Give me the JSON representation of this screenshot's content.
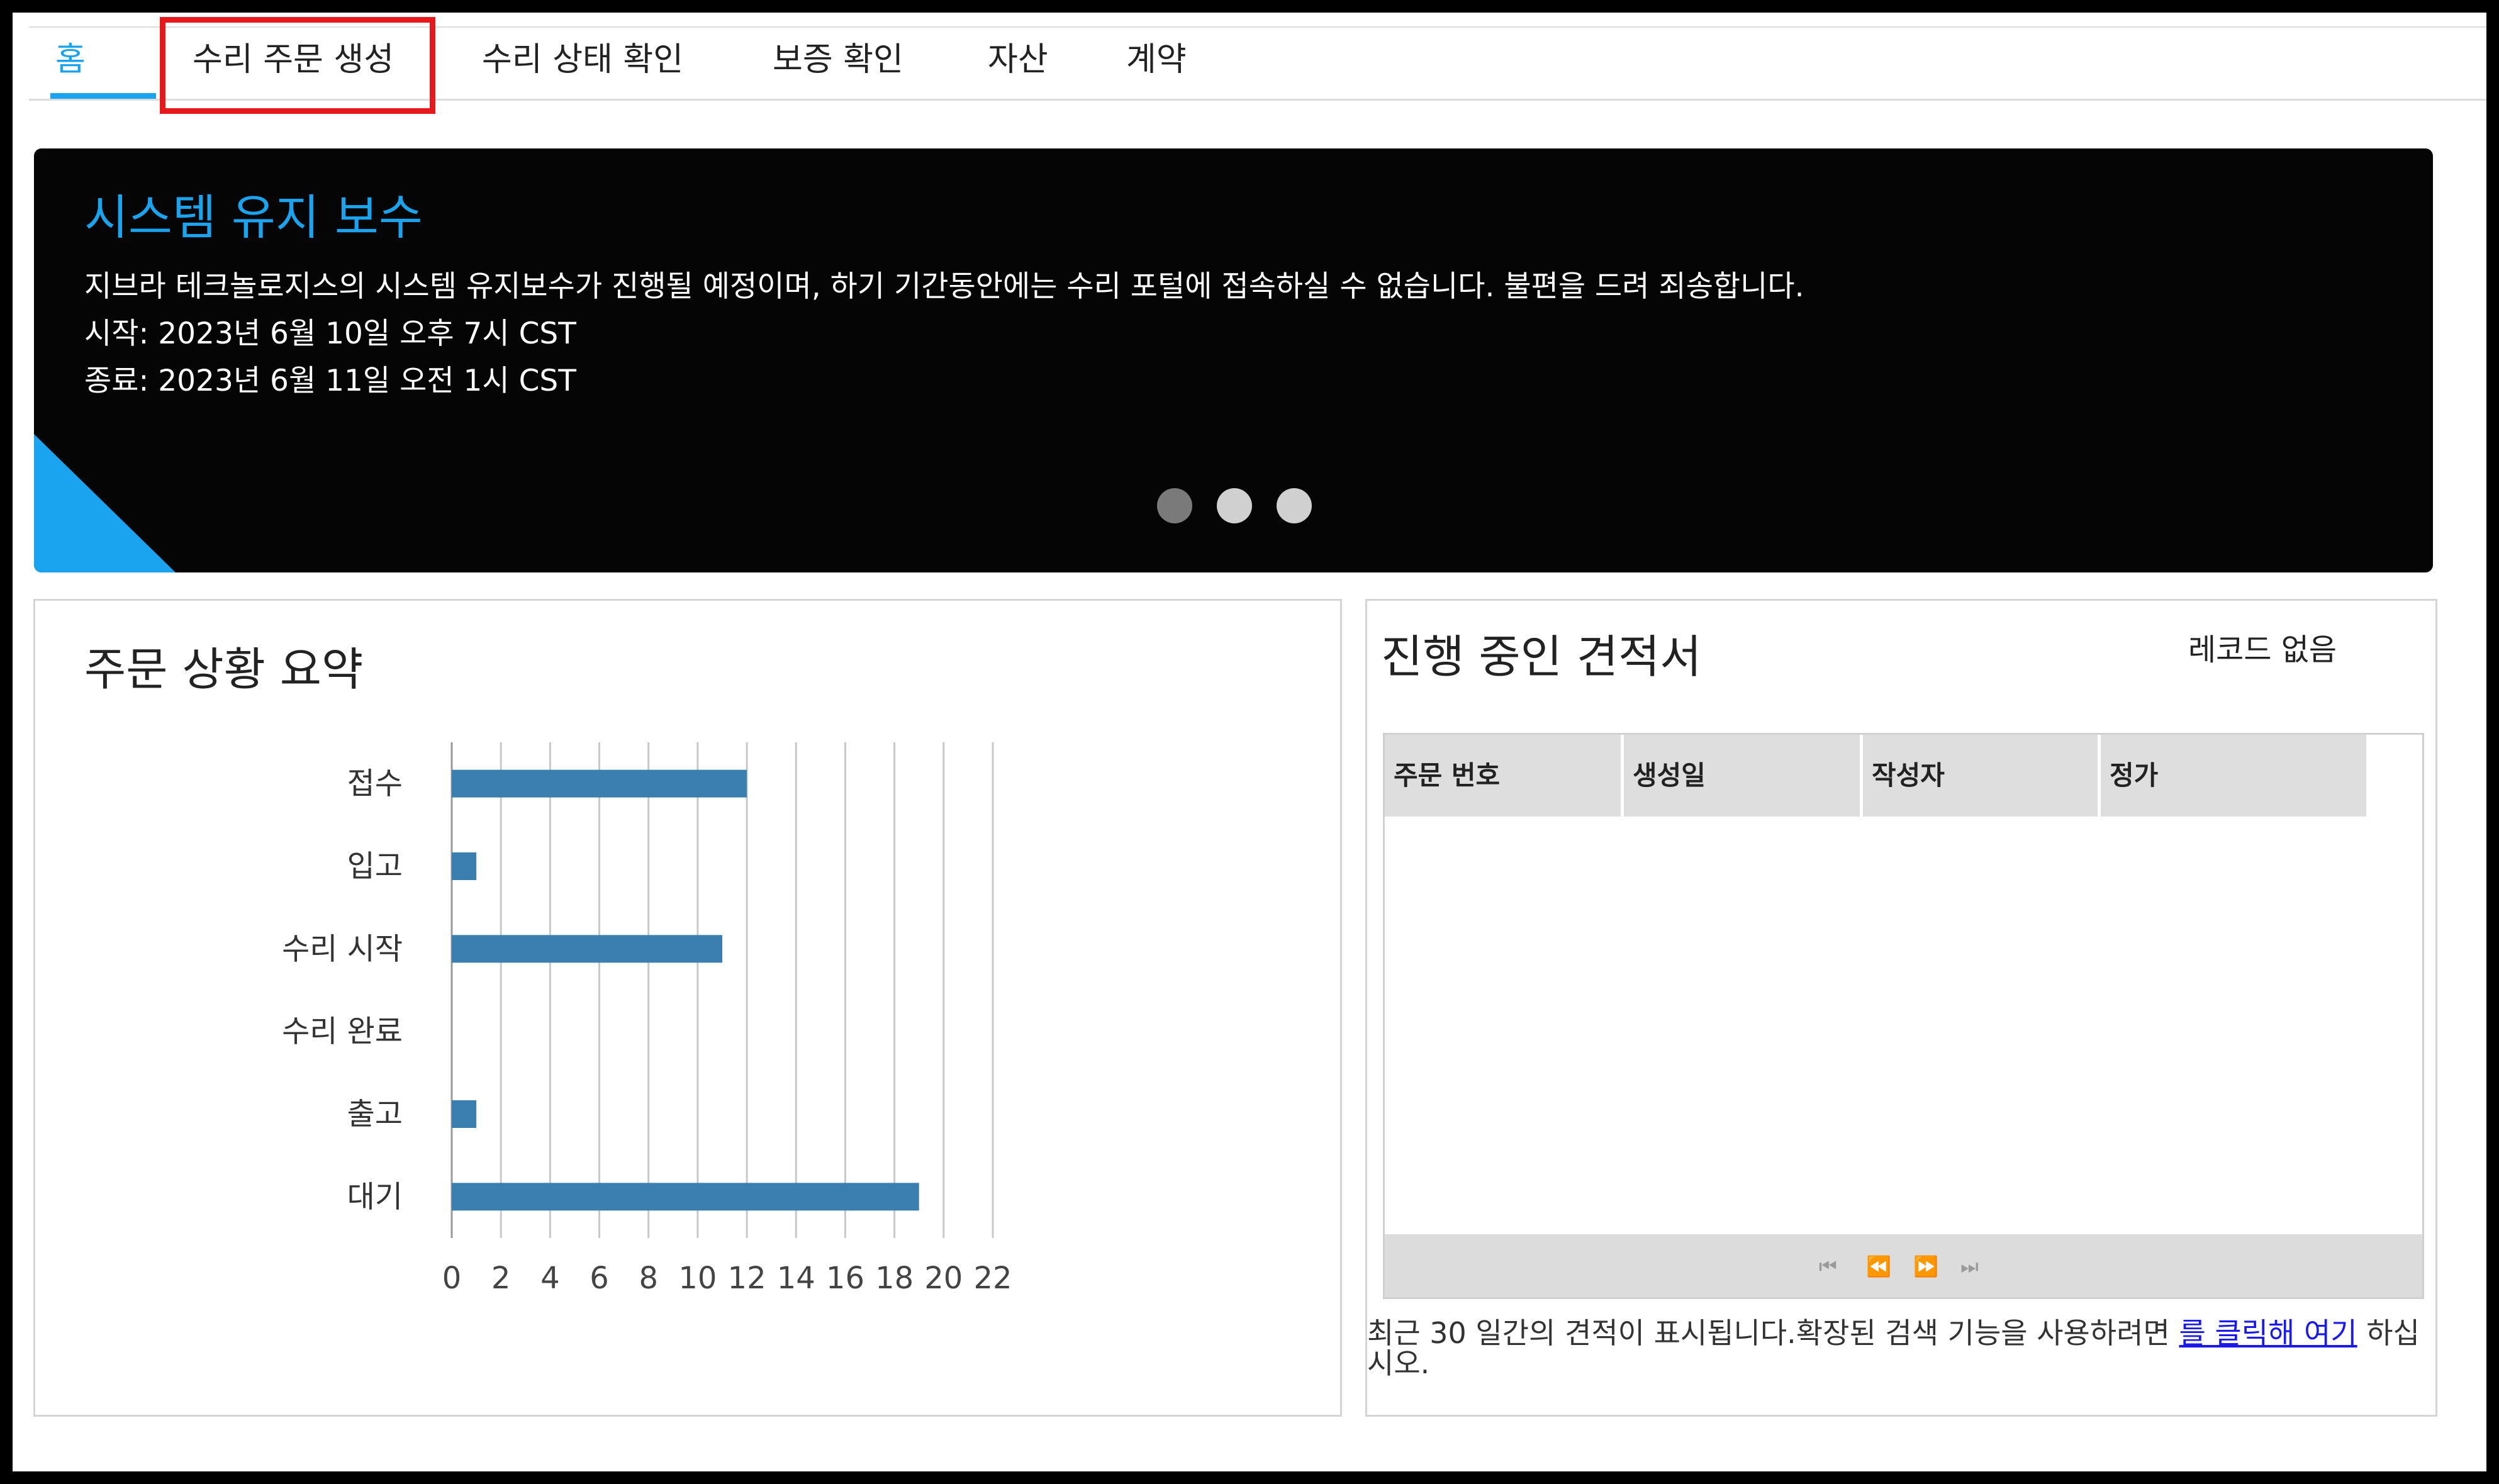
{
  "tabs": [
    {
      "label": "홈",
      "active": true
    },
    {
      "label": "수리 주문 생성",
      "active": false,
      "highlighted": true
    },
    {
      "label": "수리 상태 확인",
      "active": false
    },
    {
      "label": "보증 확인",
      "active": false
    },
    {
      "label": "자산",
      "active": false
    },
    {
      "label": "계약",
      "active": false
    }
  ],
  "banner": {
    "title": "시스템 유지 보수",
    "message": "지브라 테크놀로지스의 시스템 유지보수가 진행될 예정이며, 하기 기간동안에는 수리 포털에 접속하실 수 없습니다. 불편을 드려 죄송합니다.",
    "start": "시작: 2023년 6월 10일 오후 7시 CST",
    "end": "종료: 2023년 6월 11일 오전 1시 CST",
    "slides": 3,
    "active_slide": 1
  },
  "summary": {
    "title": "주문 상황 요약"
  },
  "chart_data": {
    "type": "bar",
    "orientation": "horizontal",
    "categories": [
      "접수",
      "입고",
      "수리 시작",
      "수리 완료",
      "출고",
      "대기"
    ],
    "values": [
      12,
      1,
      11,
      0,
      1,
      19
    ],
    "xlim": [
      0,
      22
    ],
    "xticks": [
      0,
      2,
      4,
      6,
      8,
      10,
      12,
      14,
      16,
      18,
      20,
      22
    ],
    "grid": true,
    "color": "#3a7fb0"
  },
  "quotes": {
    "title": "진행 중인 견적서",
    "no_records": "레코드 없음",
    "columns": [
      "주문 번호",
      "생성일",
      "작성자",
      "정가"
    ],
    "rows": [],
    "pager": {
      "first": "⏮",
      "prev": "⏪",
      "next": "⏩",
      "last": "⏭"
    },
    "note_prefix": "최근 30 일간의 견적이 표시됩니다.확장된 검색 기능을 사용하려면 ",
    "note_link": "를 클릭해 여기",
    "note_suffix": " 하십시오."
  },
  "colors": {
    "accent": "#1aa3ee",
    "highlight": "#e8191c",
    "bar": "#3a7fb0"
  }
}
